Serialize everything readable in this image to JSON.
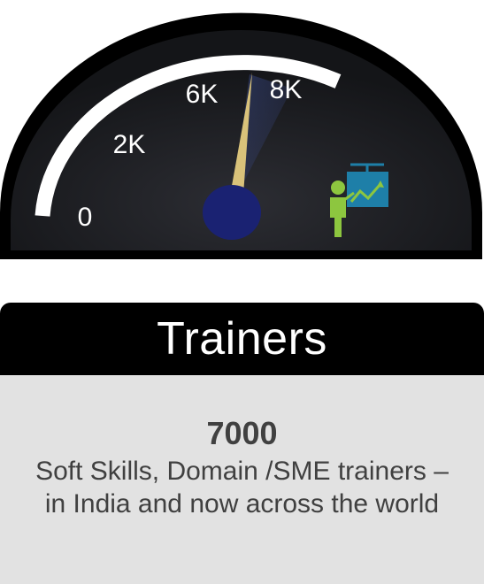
{
  "gauge": {
    "reading": 7000,
    "scale_max": 10000,
    "tick_labels": [
      "0",
      "2K",
      "6K",
      "8K"
    ],
    "icon": "presenter-chart-icon",
    "colors": {
      "dial": "#1b1c20",
      "bezel": "#000000",
      "arc": "#ffffff",
      "needle": "#d9c27a",
      "hub": "#1a2272",
      "icon_person": "#8dc63f",
      "icon_board": "#1e7fa8"
    }
  },
  "title": "Trainers",
  "info": {
    "value": "7000",
    "description": "Soft Skills, Domain /SME trainers – in India and now across the world"
  }
}
